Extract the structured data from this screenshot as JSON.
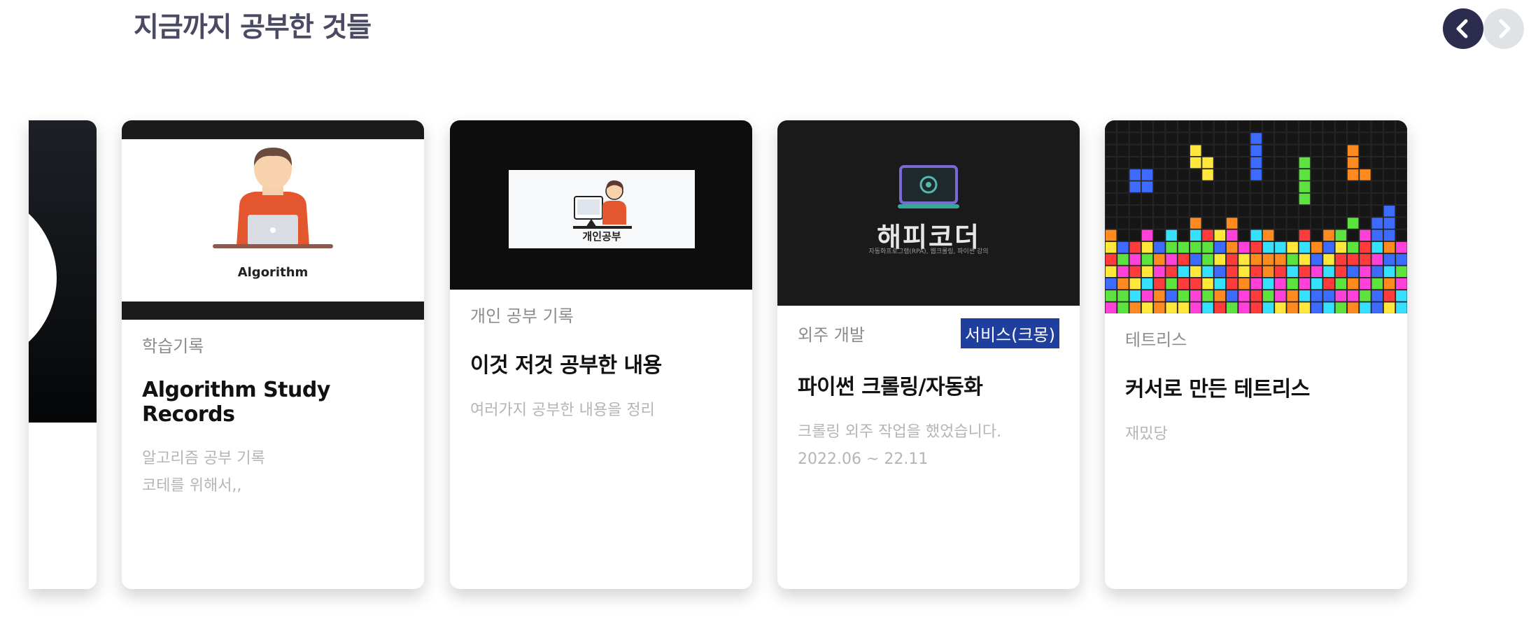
{
  "section": {
    "title": "지금까지 공부한 것들"
  },
  "nav": {
    "prev_icon": "chevron-left-icon",
    "next_icon": "chevron-right-icon"
  },
  "cards": [
    {
      "category": "학습기록",
      "title": "Algorithm Study Records",
      "desc": "알고리즘 공부 기록\n코테를 위해서,,",
      "thumb_caption": "Algorithm"
    },
    {
      "category": "개인 공부 기록",
      "title": "이것 저것 공부한 내용",
      "desc": "여러가지 공부한 내용을 정리",
      "thumb_caption": "개인공부"
    },
    {
      "category": "외주 개발",
      "badge": "서비스(크몽)",
      "title": "파이썬 크롤링/자동화",
      "desc": "크롤링 외주 작업을 했었습니다.\n2022.06 ~ 22.11",
      "thumb_brand": "해피코더",
      "thumb_sub": "자동화프로그램(RPA), 웹크롤링, 파이썬 강의"
    },
    {
      "category": "테트리스",
      "title": "커서로 만든 테트리스",
      "desc": "재밌당"
    }
  ],
  "colors": {
    "accent": "#2c2c4f",
    "badge": "#1f3f9e",
    "muted": "#b5b5b5"
  }
}
